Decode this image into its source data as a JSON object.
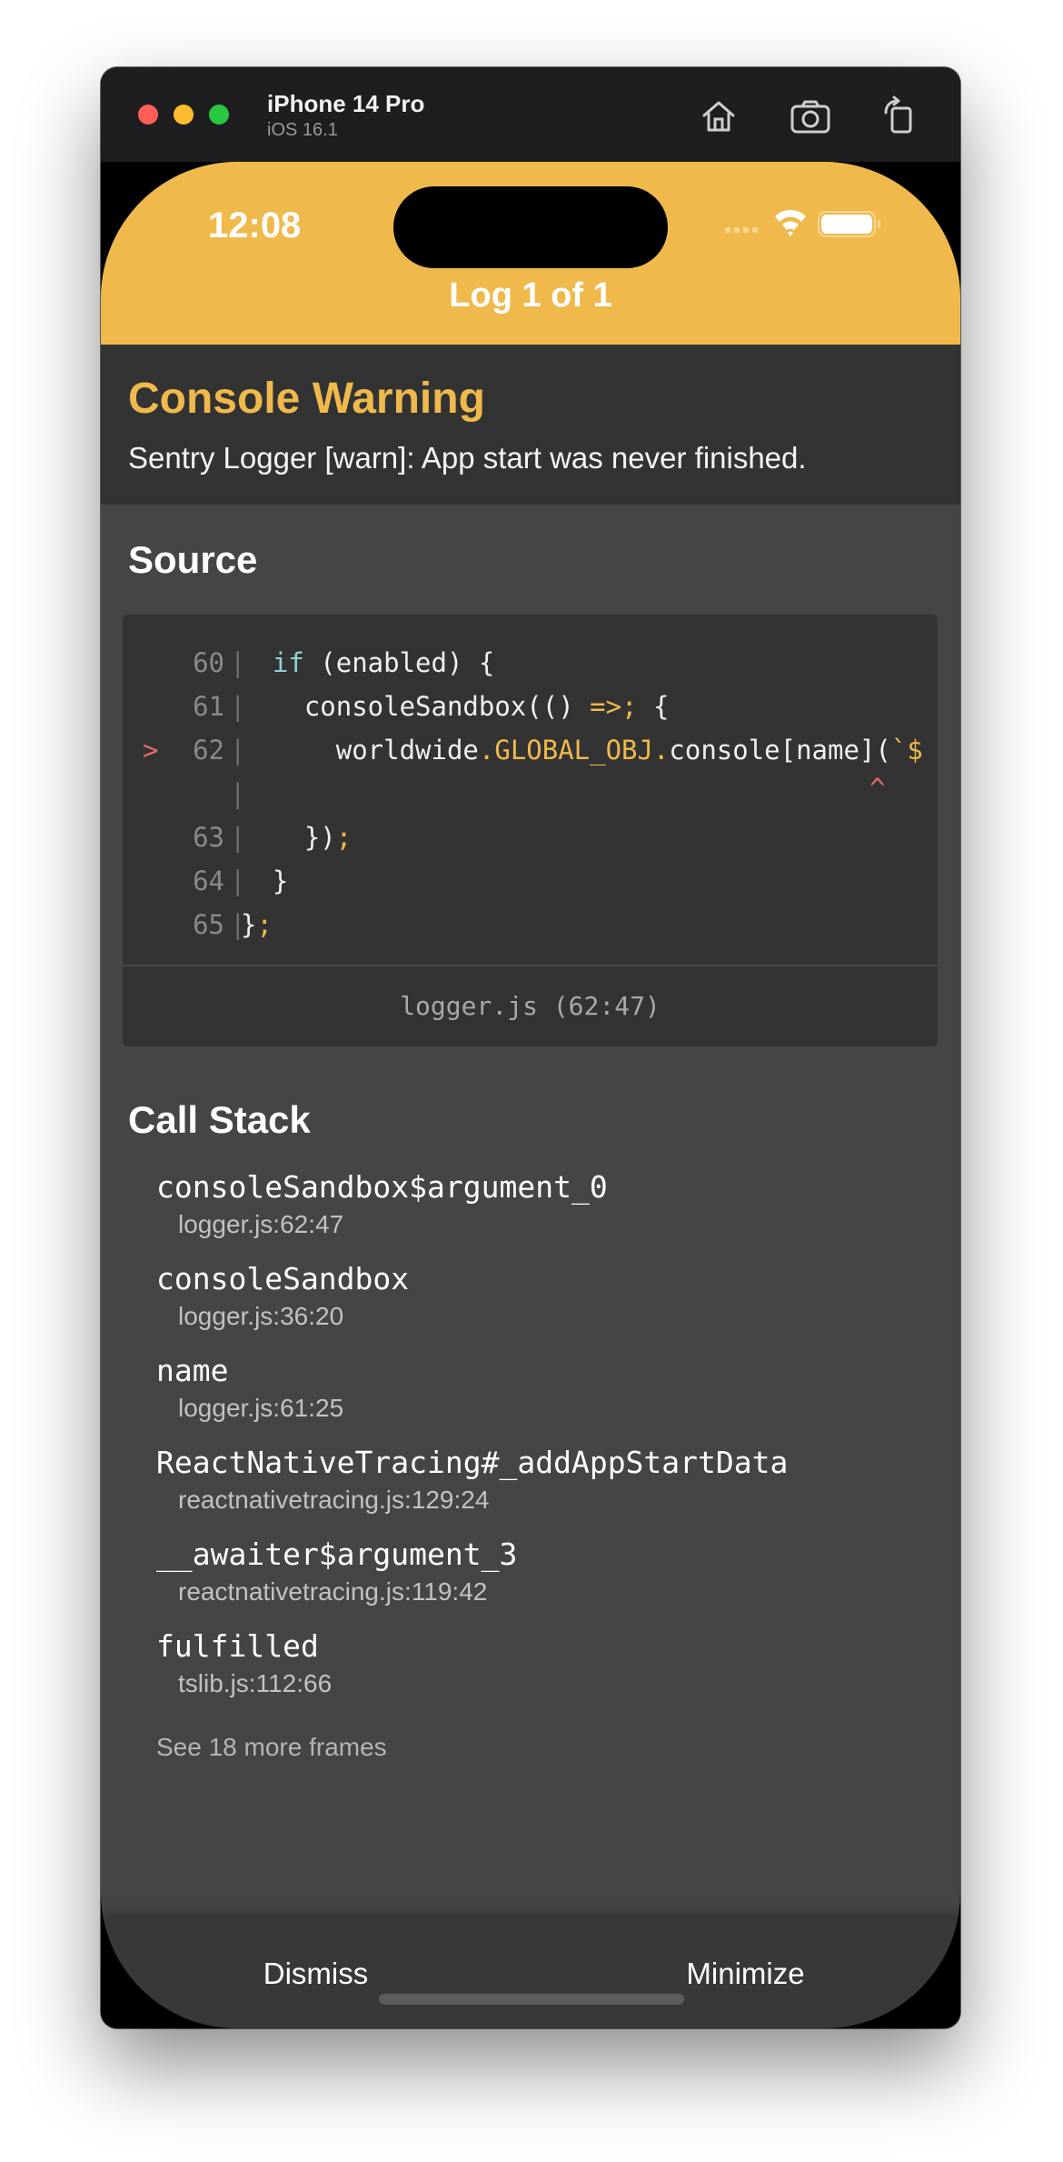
{
  "simulator": {
    "device_name": "iPhone 14 Pro",
    "os_version": "iOS 16.1",
    "toolbar_icons": [
      "home-icon",
      "screenshot-icon",
      "rotate-icon"
    ]
  },
  "status_bar": {
    "time": "12:08",
    "icons": [
      "cellular-icon",
      "wifi-icon",
      "battery-icon"
    ]
  },
  "header": {
    "title": "Log 1 of 1",
    "color": "#efb94c"
  },
  "warning": {
    "title": "Console Warning",
    "message": "Sentry Logger [warn]: App start was never finished."
  },
  "source": {
    "heading": "Source",
    "lines": [
      {
        "marker": "",
        "num": "60",
        "sep": "|",
        "text": "  if (enabled) {"
      },
      {
        "marker": "",
        "num": "61",
        "sep": "|",
        "text": "    consoleSandbox(() => {"
      },
      {
        "marker": ">",
        "num": "62",
        "sep": "|",
        "text": "      worldwide.GLOBAL_OBJ.console[name](`$"
      },
      {
        "marker": "",
        "num": "",
        "sep": "|",
        "text": "",
        "caret": "^"
      },
      {
        "marker": "",
        "num": "63",
        "sep": "|",
        "text": "    });"
      },
      {
        "marker": "",
        "num": "64",
        "sep": "|",
        "text": "  }"
      },
      {
        "marker": "",
        "num": "65",
        "sep": "|",
        "text": "};"
      }
    ],
    "location": "logger.js (62:47)"
  },
  "call_stack": {
    "heading": "Call Stack",
    "frames": [
      {
        "name": "consoleSandbox$argument_0",
        "location": "logger.js:62:47"
      },
      {
        "name": "consoleSandbox",
        "location": "logger.js:36:20"
      },
      {
        "name": "name",
        "location": "logger.js:61:25"
      },
      {
        "name": "ReactNativeTracing#_addAppStartData",
        "location": "reactnativetracing.js:129:24"
      },
      {
        "name": "__awaiter$argument_3",
        "location": "reactnativetracing.js:119:42"
      },
      {
        "name": "fulfilled",
        "location": "tslib.js:112:66"
      }
    ],
    "see_more": "See 18 more frames"
  },
  "actions": {
    "dismiss": "Dismiss",
    "minimize": "Minimize"
  }
}
